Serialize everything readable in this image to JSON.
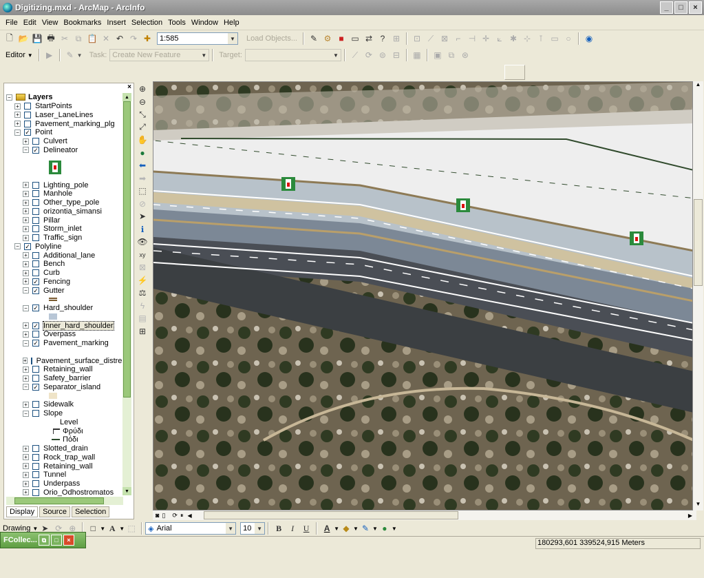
{
  "window": {
    "title": "Digitizing.mxd - ArcMap - ArcInfo"
  },
  "menu": [
    "File",
    "Edit",
    "View",
    "Bookmarks",
    "Insert",
    "Selection",
    "Tools",
    "Window",
    "Help"
  ],
  "standard_toolbar": {
    "scale": "1:585",
    "load_objects": "Load Objects..."
  },
  "editor_toolbar": {
    "editor": "Editor",
    "task_label": "Task:",
    "task_value": "Create New Feature",
    "target_label": "Target:",
    "target_value": ""
  },
  "toc": {
    "root": "Layers",
    "items": [
      {
        "label": "StartPoints",
        "checked": false,
        "level": 1,
        "exp": "+"
      },
      {
        "label": "Laser_LaneLines",
        "checked": false,
        "level": 1,
        "exp": "+"
      },
      {
        "label": "Pavement_marking_plg",
        "checked": false,
        "level": 1,
        "exp": "+"
      },
      {
        "label": "Point",
        "checked": true,
        "level": 1,
        "exp": "-"
      },
      {
        "label": "Culvert",
        "checked": false,
        "level": 2,
        "exp": "+"
      },
      {
        "label": "Delineator",
        "checked": true,
        "level": 2,
        "exp": "-"
      },
      {
        "label": "Lighting_pole",
        "checked": false,
        "level": 2,
        "exp": "+"
      },
      {
        "label": "Manhole",
        "checked": false,
        "level": 2,
        "exp": "+"
      },
      {
        "label": "Other_type_pole",
        "checked": false,
        "level": 2,
        "exp": "+"
      },
      {
        "label": "orizontia_simansi",
        "checked": false,
        "level": 2,
        "exp": "+"
      },
      {
        "label": "Pillar",
        "checked": false,
        "level": 2,
        "exp": "+"
      },
      {
        "label": "Storm_inlet",
        "checked": false,
        "level": 2,
        "exp": "+"
      },
      {
        "label": "Traffic_sign",
        "checked": false,
        "level": 2,
        "exp": "+"
      },
      {
        "label": "Polyline",
        "checked": true,
        "level": 1,
        "exp": "-"
      },
      {
        "label": "Additional_lane",
        "checked": false,
        "level": 2,
        "exp": "+"
      },
      {
        "label": "Bench",
        "checked": false,
        "level": 2,
        "exp": "+"
      },
      {
        "label": "Curb",
        "checked": false,
        "level": 2,
        "exp": "+"
      },
      {
        "label": "Fencing",
        "checked": true,
        "level": 2,
        "exp": "+"
      },
      {
        "label": "Gutter",
        "checked": true,
        "level": 2,
        "exp": "-"
      },
      {
        "label": "Hard_shoulder",
        "checked": true,
        "level": 2,
        "exp": "-"
      },
      {
        "label": "Inner_hard_shoulder",
        "checked": true,
        "level": 2,
        "exp": "+"
      },
      {
        "label": "Overpass",
        "checked": false,
        "level": 2,
        "exp": "+"
      },
      {
        "label": "Pavement_marking",
        "checked": true,
        "level": 2,
        "exp": "-"
      },
      {
        "label": "Pavement_surface_distress",
        "checked": false,
        "level": 2,
        "exp": "+"
      },
      {
        "label": "Retaining_wall",
        "checked": false,
        "level": 2,
        "exp": "+"
      },
      {
        "label": "Safety_barrier",
        "checked": false,
        "level": 2,
        "exp": "+"
      },
      {
        "label": "Separator_island",
        "checked": true,
        "level": 2,
        "exp": "-"
      },
      {
        "label": "Sidewalk",
        "checked": false,
        "level": 2,
        "exp": "+"
      },
      {
        "label": "Slope",
        "checked": false,
        "level": 2,
        "exp": "-"
      },
      {
        "label": "Slotted_drain",
        "checked": false,
        "level": 2,
        "exp": "+"
      },
      {
        "label": "Rock_trap_wall",
        "checked": false,
        "level": 2,
        "exp": "+"
      },
      {
        "label": "Retaining_wall",
        "checked": false,
        "level": 2,
        "exp": "+"
      },
      {
        "label": "Tunnel",
        "checked": false,
        "level": 2,
        "exp": "+"
      },
      {
        "label": "Underpass",
        "checked": false,
        "level": 2,
        "exp": "+"
      },
      {
        "label": "Orio_Odhostromatos",
        "checked": false,
        "level": 2,
        "exp": "+"
      }
    ],
    "slope_legend": {
      "title": "Level",
      "items": [
        "Φρύδι",
        "Πόδι"
      ]
    },
    "tabs": [
      "Display",
      "Source",
      "Selection"
    ]
  },
  "drawing_toolbar": {
    "drawing": "Drawing",
    "font": "Arial",
    "size": "10"
  },
  "status": {
    "coords": "180293,601  339524,915 Meters"
  },
  "taskbar": {
    "label": "FCollec..."
  }
}
